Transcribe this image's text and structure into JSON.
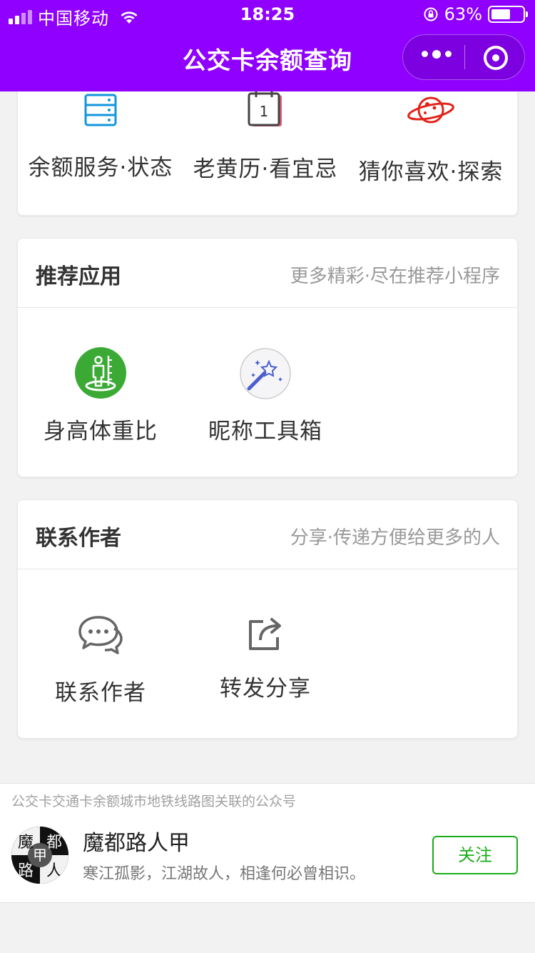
{
  "status_bar": {
    "carrier": "中国移动",
    "time": "18:25",
    "battery_text": "63%",
    "battery_level": 0.63
  },
  "nav": {
    "title": "公交卡余额查询",
    "more_icon": "more-dots-icon",
    "close_icon": "target-circle-icon"
  },
  "top_card": {
    "items": [
      {
        "label": "余额服务·状态",
        "icon": "server-stack-icon"
      },
      {
        "label": "老黄历·看宜忌",
        "icon": "calendar-icon"
      },
      {
        "label": "猜你喜欢·探索",
        "icon": "planet-icon"
      }
    ]
  },
  "recommend": {
    "title": "推荐应用",
    "subtitle": "更多精彩·尽在推荐小程序",
    "items": [
      {
        "label": "身高体重比",
        "icon": "height-measure-icon"
      },
      {
        "label": "昵称工具箱",
        "icon": "magic-wand-icon"
      }
    ]
  },
  "contact": {
    "title": "联系作者",
    "subtitle": "分享·传递方便给更多的人",
    "items": [
      {
        "label": "联系作者",
        "icon": "chat-bubbles-icon"
      },
      {
        "label": "转发分享",
        "icon": "share-icon"
      }
    ]
  },
  "official_account": {
    "description": "公交卡交通卡余额城市地铁线路图关联的公众号",
    "name": "魔都路人甲",
    "motto": "寒江孤影，江湖故人，相逢何必曾相识。",
    "follow_label": "关注",
    "avatar_text": "魔都路人甲"
  },
  "colors": {
    "nav_bg": "#8f00ff",
    "follow_green": "#1aad19",
    "icon_blue": "#1296db",
    "icon_red": "#e2231a",
    "icon_green": "#3aaa35"
  }
}
